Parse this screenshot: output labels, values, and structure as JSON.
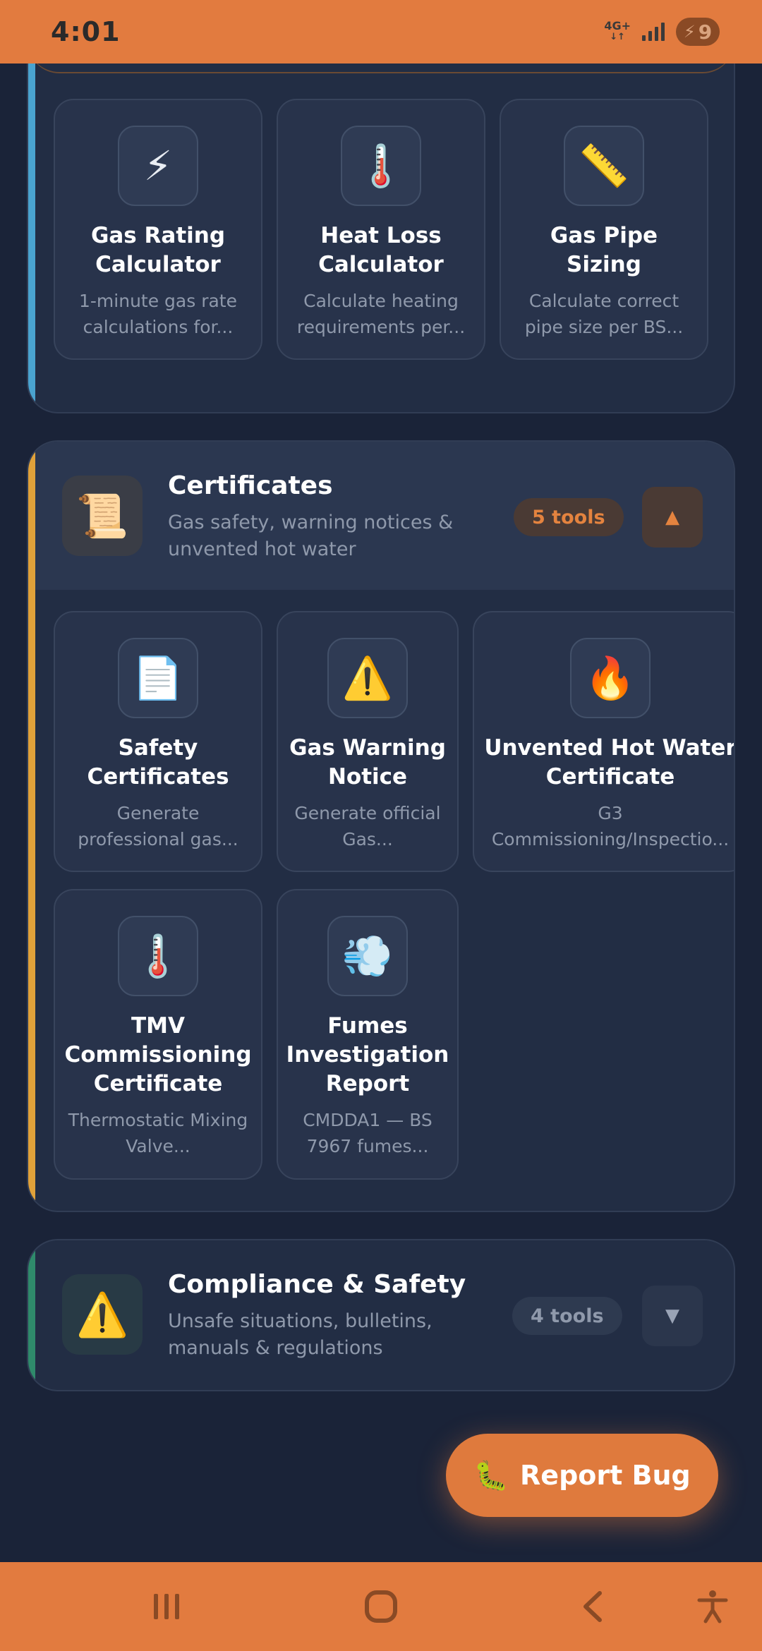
{
  "status_bar": {
    "time": "4:01",
    "network": "4G+",
    "battery": "9"
  },
  "colors": {
    "accent_orange": "#e27b3f",
    "background": "#1a2338",
    "card": "#222d44",
    "stripe_blue": "#4aa3cf",
    "stripe_orange": "#e0a13a",
    "stripe_green": "#2f8a6b"
  },
  "calculators": {
    "tiles": [
      {
        "icon": "⚡",
        "icon_name": "lightning-icon",
        "title": "Gas Rating Calculator",
        "desc": "1-minute gas rate calculations for..."
      },
      {
        "icon": "🌡️",
        "icon_name": "thermometer-icon",
        "title": "Heat Loss Calculator",
        "desc": "Calculate heating requirements per..."
      },
      {
        "icon": "📏",
        "icon_name": "ruler-icon",
        "title": "Gas Pipe Sizing",
        "desc": "Calculate correct pipe size per BS..."
      }
    ]
  },
  "certificates": {
    "icon": "📜",
    "icon_name": "scroll-icon",
    "title": "Certificates",
    "subtitle": "Gas safety, warning notices & unvented hot water",
    "count": "5 tools",
    "toggle": "▲",
    "tiles": [
      {
        "icon": "📄",
        "icon_name": "document-icon",
        "title": "Safety Certificates",
        "desc": "Generate professional gas..."
      },
      {
        "icon": "⚠️",
        "icon_name": "warning-icon",
        "title": "Gas Warning Notice",
        "desc": "Generate official Gas..."
      },
      {
        "icon": "🔥",
        "icon_name": "fire-icon",
        "title": "Unvented Hot Water Certificate",
        "desc": "G3 Commissioning/Inspectio..."
      },
      {
        "icon": "🌡️",
        "icon_name": "thermometer-icon",
        "title": "TMV Commissioning Certificate",
        "desc": "Thermostatic Mixing Valve..."
      },
      {
        "icon": "💨",
        "icon_name": "dash-air-icon",
        "title": "Fumes Investigation Report",
        "desc": "CMDDA1 — BS 7967 fumes..."
      }
    ]
  },
  "compliance": {
    "icon": "⚠️",
    "icon_name": "warning-icon",
    "title": "Compliance & Safety",
    "subtitle": "Unsafe situations, bulletins, manuals & regulations",
    "count": "4 tools",
    "toggle": "▼"
  },
  "report_bug": {
    "icon": "🐛",
    "label": "Report Bug"
  }
}
